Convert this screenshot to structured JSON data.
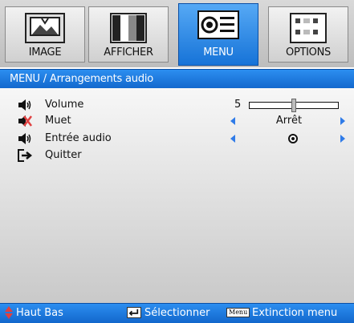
{
  "tabs": [
    {
      "label": "IMAGE",
      "icon": "image-icon"
    },
    {
      "label": "AFFICHER",
      "icon": "display-icon"
    },
    {
      "label": "MENU",
      "icon": "projector-icon"
    },
    {
      "label": "OPTIONS",
      "icon": "options-icon"
    }
  ],
  "title": "MENU / Arrangements audio",
  "rows": {
    "volume": {
      "label": "Volume",
      "value": "5",
      "level": 0.5
    },
    "mute": {
      "label": "Muet",
      "value": "Arrêt"
    },
    "audio_input": {
      "label": "Entrée audio"
    },
    "quit": {
      "label": "Quitter"
    }
  },
  "footer": {
    "nav": "Haut Bas",
    "select": "Sélectionner",
    "menu_key": "Menu",
    "exit": "Extinction menu"
  },
  "colors": {
    "active_tab": "#1673d8",
    "bar": "#1267cc",
    "arrow": "#2f7be8",
    "mute_icon": "#e04040"
  }
}
